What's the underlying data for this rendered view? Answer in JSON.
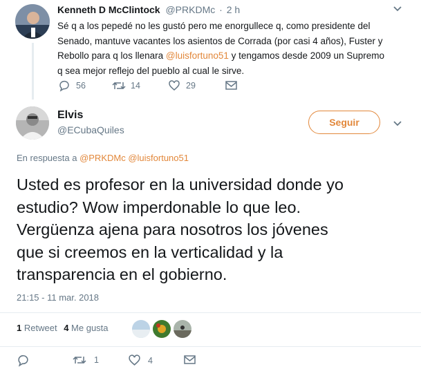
{
  "parent_tweet": {
    "author_name": "Kenneth D McClintock",
    "author_handle": "@PRKDMc",
    "separator": "·",
    "time": "2 h",
    "text_parts": [
      "Sé q a los pepedé no les gustó pero me  enorgullece q, como presidente del",
      "Senado, mantuve vacantes los asientos de Corrada (por casi 4 años), Fuster y",
      "Rebollo para q los llenara ",
      "@luisfortuno51",
      " y tengamos desde 2009 un Supremo",
      "q sea mejor reflejo del pueblo al cual le sirve."
    ],
    "replies": "56",
    "retweets": "14",
    "likes": "29"
  },
  "main_tweet": {
    "author_name": "Elvis",
    "author_handle": "@ECubaQuiles",
    "follow_label": "Seguir",
    "reply_prefix": "En respuesta a ",
    "reply_to_1": "@PRKDMc",
    "reply_to_2": "@luisfortuno51",
    "text_lines": [
      "Usted es profesor en la universidad donde yo",
      "estudio? Wow imperdonable lo que leo.",
      "Vergüenza ajena para nosotros los jóvenes",
      "que si creemos en la verticalidad y la",
      "transparencia en el gobierno."
    ],
    "timestamp": "21:15 - 11 mar. 2018",
    "retweet_count": "1",
    "retweet_label": "Retweet",
    "like_count": "4",
    "like_label": "Me gusta",
    "actions": {
      "reply_count": "",
      "retweet_count": "1",
      "like_count": "4"
    }
  },
  "colors": {
    "accent": "#e2873a",
    "muted": "#657786",
    "text": "#14171a",
    "divider": "#e6ecf0"
  }
}
